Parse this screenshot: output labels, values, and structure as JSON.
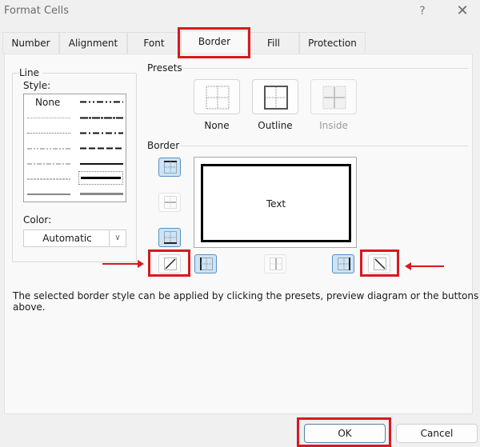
{
  "window": {
    "title": "Format Cells",
    "help_label": "?",
    "close_label": "✕"
  },
  "tabs": [
    {
      "label": "Number",
      "active": false
    },
    {
      "label": "Alignment",
      "active": false
    },
    {
      "label": "Font",
      "active": false
    },
    {
      "label": "Border",
      "active": true
    },
    {
      "label": "Fill",
      "active": false
    },
    {
      "label": "Protection",
      "active": false
    }
  ],
  "line": {
    "group_label": "Line",
    "style_label": "Style:",
    "style_none_label": "None",
    "styles_left": [
      "none",
      "hair",
      "dotted",
      "dash-dot-dot",
      "dash-dot",
      "dashed",
      "thin"
    ],
    "styles_right": [
      "medium-dash-dot-dot",
      "slant-dash-dot",
      "medium-dash-dot",
      "medium-dashed",
      "medium",
      "thick",
      "double"
    ],
    "selected_style": "thick",
    "color_label": "Color:",
    "color_value": "Automatic"
  },
  "presets": {
    "group_label": "Presets",
    "items": [
      {
        "label": "None",
        "icon": "preset-none-icon",
        "enabled": true
      },
      {
        "label": "Outline",
        "icon": "preset-outline-icon",
        "enabled": true
      },
      {
        "label": "Inside",
        "icon": "preset-inside-icon",
        "enabled": false
      }
    ]
  },
  "border": {
    "group_label": "Border",
    "preview_text": "Text",
    "buttons": {
      "top": {
        "active": true,
        "enabled": true
      },
      "inside_horizontal": {
        "active": false,
        "enabled": false
      },
      "bottom": {
        "active": true,
        "enabled": true
      },
      "diagonal_up": {
        "active": false,
        "enabled": true
      },
      "left": {
        "active": true,
        "enabled": true
      },
      "inside_vertical": {
        "active": false,
        "enabled": false
      },
      "right": {
        "active": true,
        "enabled": true
      },
      "diagonal_down": {
        "active": false,
        "enabled": true
      }
    }
  },
  "hint_text": "The selected border style can be applied by clicking the presets, preview diagram or the buttons above.",
  "footer": {
    "ok_label": "OK",
    "cancel_label": "Cancel"
  },
  "annotation_color": "#d7191f",
  "accent_color": "#cce4f7"
}
